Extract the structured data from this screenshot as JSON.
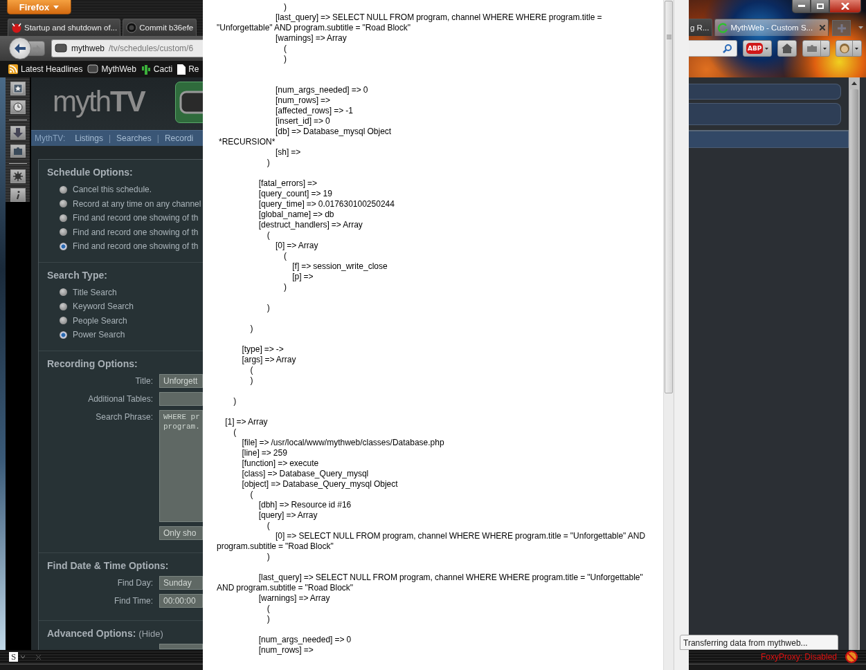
{
  "browser": {
    "menu_button": "Firefox",
    "tabs": [
      {
        "title": "Startup and shutdown of...",
        "selected": false
      },
      {
        "title": "Commit b36efe",
        "selected": false
      },
      {
        "title": "g R...",
        "selected": false
      },
      {
        "title": "MythWeb - Custom S...",
        "selected": true
      }
    ],
    "address": {
      "host": "mythweb",
      "path": "/tv/schedules/custom/6"
    },
    "adblock_label": "ABP",
    "bookmarks": [
      {
        "label": "Latest Headlines"
      },
      {
        "label": "MythWeb"
      },
      {
        "label": "Cacti"
      },
      {
        "label": "Re"
      }
    ]
  },
  "page": {
    "logo": "myth**TV**",
    "nav": {
      "label": "MythTV:",
      "items": [
        {
          "kind": "link",
          "text": "Listings"
        },
        {
          "kind": "separator",
          "text": "|"
        },
        {
          "kind": "link",
          "text": "Searches"
        },
        {
          "kind": "separator",
          "text": "|"
        },
        {
          "kind": "link",
          "text": "Recordi"
        }
      ]
    },
    "sections": [
      {
        "heading": "Schedule Options:",
        "kind": "radios",
        "options": [
          {
            "label": "Cancel this schedule.",
            "selected": false
          },
          {
            "label": "Record at any time on any channel",
            "selected": false
          },
          {
            "label": "Find and record one showing of th",
            "selected": false
          },
          {
            "label": "Find and record one showing of th",
            "selected": false
          },
          {
            "label": "Find and record one showing of th",
            "selected": true
          }
        ]
      },
      {
        "heading": "Search Type:",
        "kind": "radios",
        "options": [
          {
            "label": "Title Search",
            "selected": false
          },
          {
            "label": "Keyword Search",
            "selected": false
          },
          {
            "label": "People Search",
            "selected": false
          },
          {
            "label": "Power Search",
            "selected": true
          }
        ]
      },
      {
        "heading": "Recording Options:",
        "kind": "fields",
        "fields": [
          {
            "kind": "input",
            "label": "Title:",
            "value": "Unforgett"
          },
          {
            "kind": "input",
            "label": "Additional Tables:"
          },
          {
            "kind": "textarea",
            "label": "Search Phrase:",
            "value": "WHERE pr\nprogram."
          },
          {
            "kind": "select",
            "value": "Only sho"
          }
        ]
      },
      {
        "heading": "Find Date & Time Options:",
        "kind": "fields",
        "fields": [
          {
            "kind": "select",
            "label": "Find Day:",
            "value": "Sunday"
          },
          {
            "kind": "input",
            "label": "Find Time:",
            "value": "00:00:00"
          }
        ]
      },
      {
        "heading": "Advanced Options:",
        "kind": "collapsible",
        "toggle": "(Hide)"
      }
    ]
  },
  "debug_output": "                                )\n                            [last_query] => SELECT NULL FROM program, channel WHERE WHERE program.title =\n\"Unforgettable\" AND program.subtitle = \"Road Block\"\n                            [warnings] => Array\n                                (\n                                )\n\n\n                            [num_args_needed] => 0\n                            [num_rows] =>\n                            [affected_rows] => -1\n                            [insert_id] => 0\n                            [db] => Database_mysql Object\n *RECURSION*\n                            [sh] =>\n                        )\n\n                    [fatal_errors] =>\n                    [query_count] => 19\n                    [query_time] => 0.017630100250244\n                    [global_name] => db\n                    [destruct_handlers] => Array\n                        (\n                            [0] => Array\n                                (\n                                    [f] => session_write_close\n                                    [p] =>\n                                )\n\n                        )\n\n                )\n\n            [type] => ->\n            [args] => Array\n                (\n                )\n\n        )\n\n    [1] => Array\n        (\n            [file] => /usr/local/www/mythweb/classes/Database.php\n            [line] => 259\n            [function] => execute\n            [class] => Database_Query_mysql\n            [object] => Database_Query_mysql Object\n                (\n                    [dbh] => Resource id #16\n                    [query] => Array\n                        (\n                            [0] => SELECT NULL FROM program, channel WHERE WHERE program.title = \"Unforgettable\" AND\nprogram.subtitle = \"Road Block\"\n                        )\n\n                    [last_query] => SELECT NULL FROM program, channel WHERE WHERE program.title = \"Unforgettable\"\nAND program.subtitle = \"Road Block\"\n                    [warnings] => Array\n                        (\n                        )\n\n                    [num_args_needed] => 0\n                    [num_rows] =>",
  "status": {
    "left_icon": "S",
    "transfer": "Transferring data from mythweb...",
    "proxy": "FoxyProxy: Disabled"
  }
}
